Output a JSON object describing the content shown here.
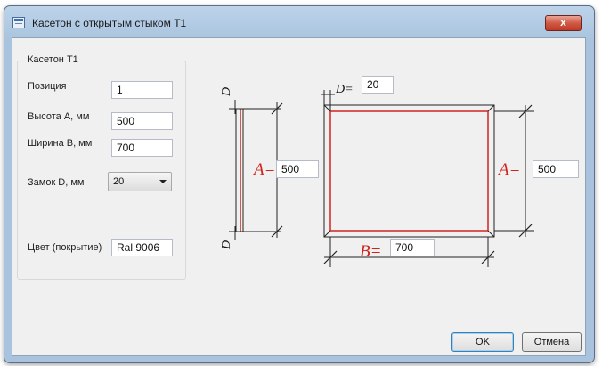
{
  "window": {
    "title": "Касетон с открытым стыком Т1",
    "close_glyph": "x",
    "icon": "window-form-icon"
  },
  "group": {
    "title": "Касетон Т1",
    "position": {
      "label": "Позиция",
      "value": "1"
    },
    "height_a": {
      "label": "Высота А, мм",
      "value": "500"
    },
    "width_b": {
      "label": "Ширина В, мм",
      "value": "700"
    },
    "lock_d": {
      "label": "Замок D, мм",
      "value": "20"
    },
    "color": {
      "label": "Цвет (покрытие)",
      "value": "Ral 9006"
    }
  },
  "drawing": {
    "letters": {
      "a": "A=",
      "b": "B=",
      "d": "D",
      "d_eq": "D="
    },
    "side_a_value": "500",
    "front_a_value": "500",
    "b_value": "700",
    "d_value": "20",
    "outline_color": "#d0231f"
  },
  "buttons": {
    "ok": "OK",
    "cancel": "Отмена"
  }
}
